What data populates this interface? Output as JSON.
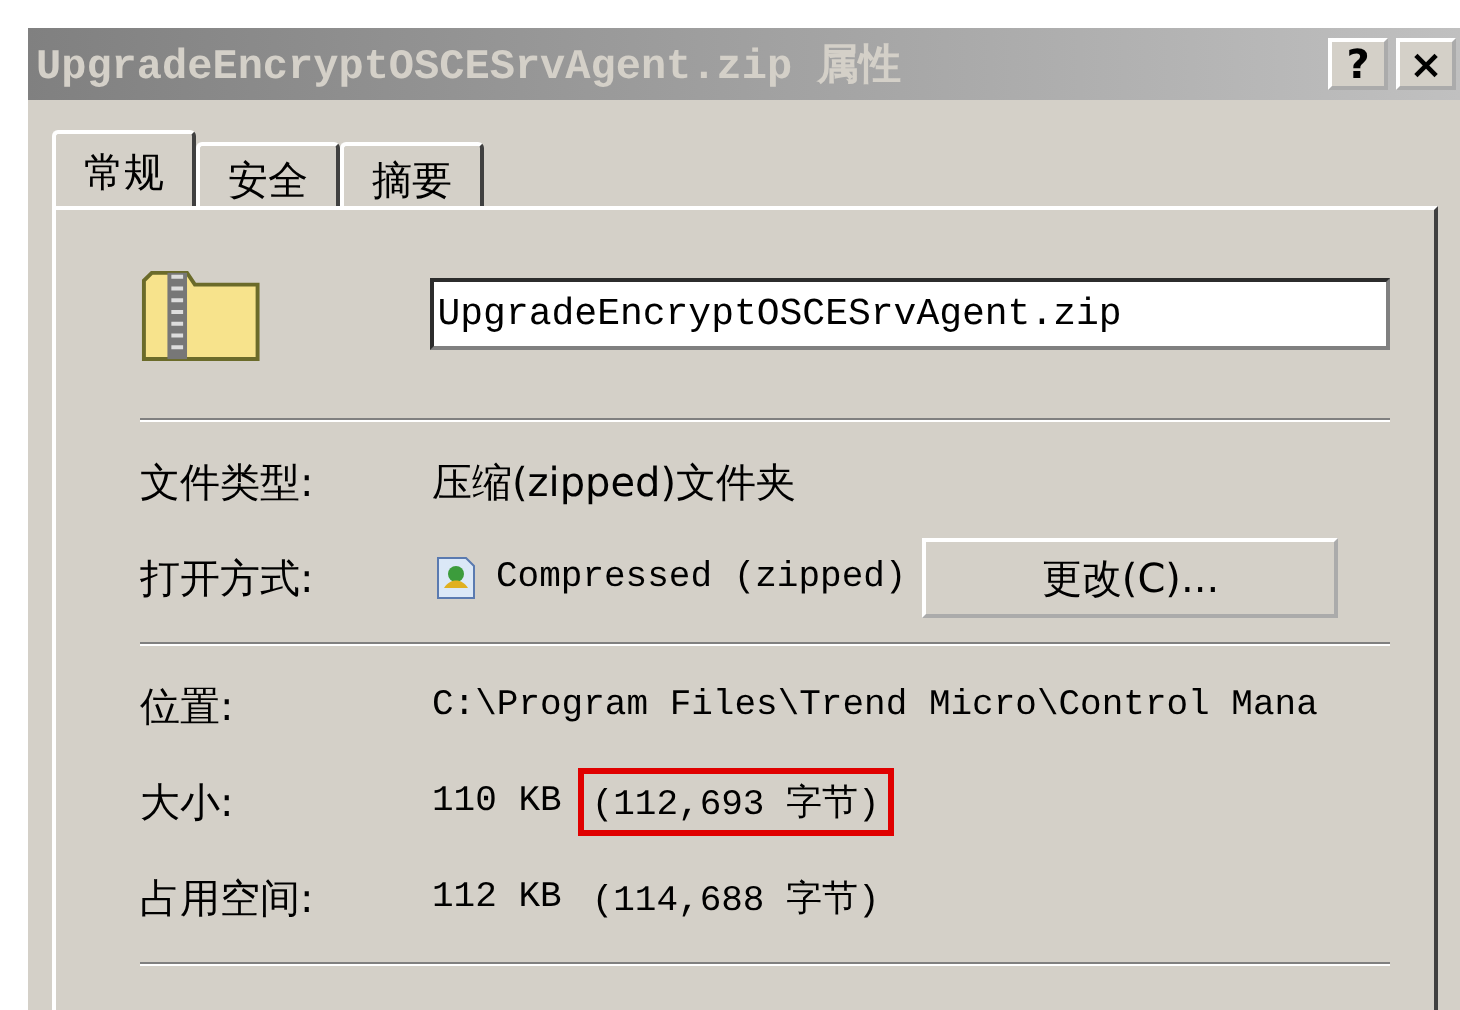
{
  "window": {
    "title": "UpgradeEncryptOSCESrvAgent.zip 属性",
    "buttons": [
      "?",
      "×"
    ]
  },
  "tabs": [
    {
      "label": "常规",
      "selected": true
    },
    {
      "label": "安全",
      "selected": false
    },
    {
      "label": "摘要",
      "selected": false
    }
  ],
  "file_name": {
    "value": "UpgradeEncryptOSCESrvAgent.zip"
  },
  "sections": [
    [
      {
        "kind": "text",
        "label": "文件类型:",
        "value": "压缩(zipped)文件夹"
      },
      {
        "kind": "opens_with",
        "label": "打开方式:",
        "value": "Compressed (zipped)",
        "button": "更改(C)..."
      }
    ],
    [
      {
        "kind": "path",
        "label": "位置:",
        "value": "C:\\Program Files\\Trend Micro\\Control Mana"
      },
      {
        "kind": "size",
        "label": "大小:",
        "value": "110 KB",
        "detail": "(112,693 字节)",
        "highlighted": true
      },
      {
        "kind": "size",
        "label": "占用空间:",
        "value": "112 KB",
        "detail": "(114,688 字节)",
        "highlighted": false
      }
    ]
  ]
}
